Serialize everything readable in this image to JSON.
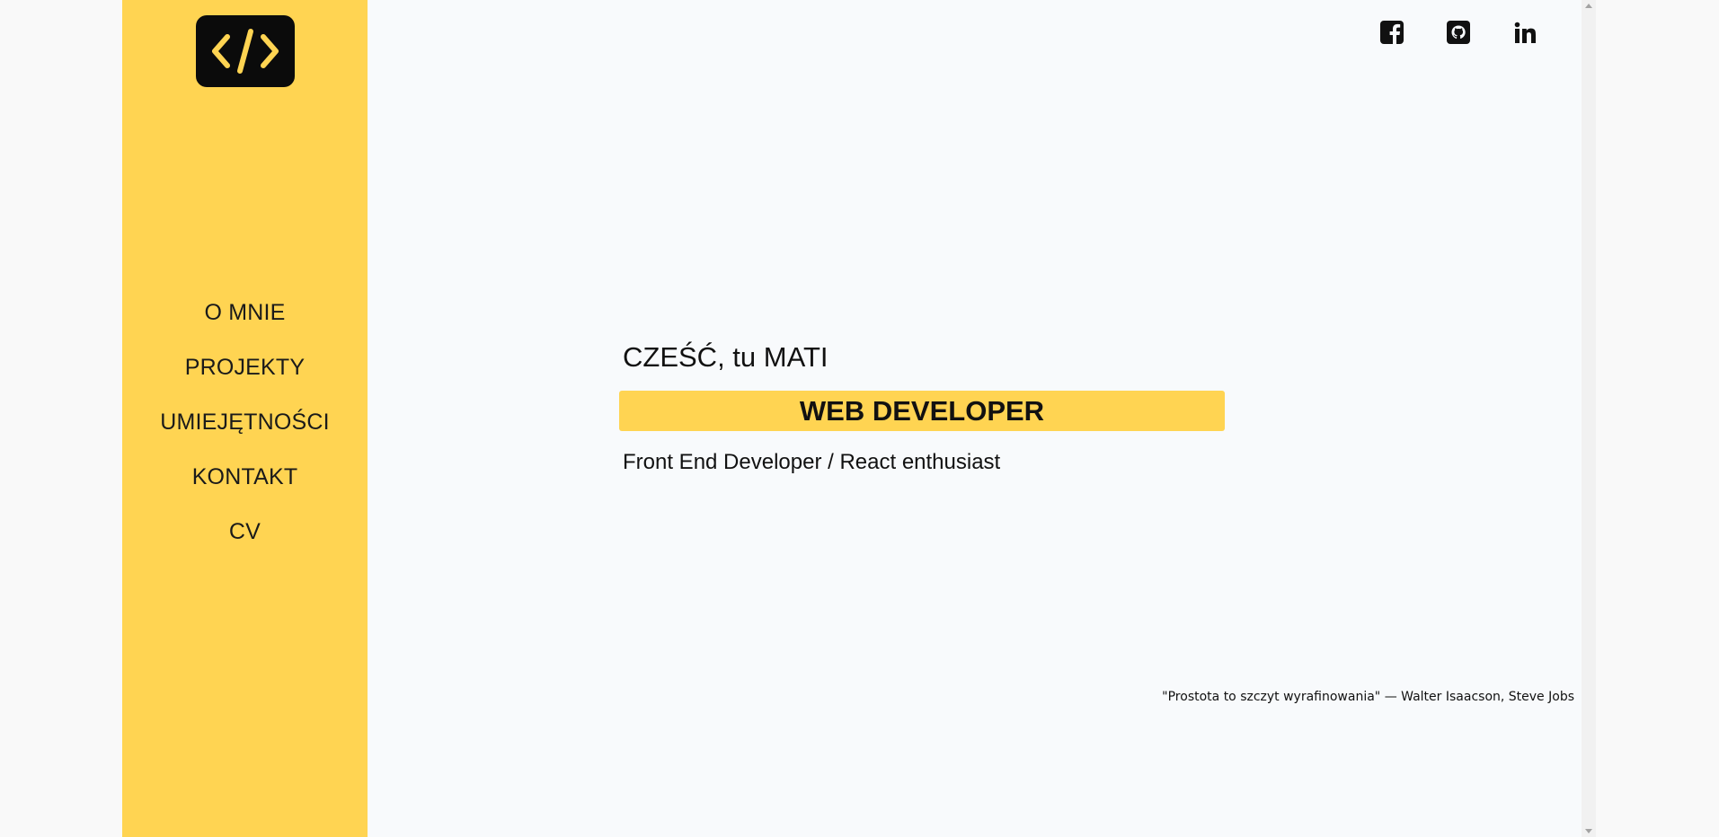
{
  "sidebar": {
    "logo_icon": "code-brackets-icon",
    "items": [
      {
        "label": "O MNIE"
      },
      {
        "label": "PROJEKTY"
      },
      {
        "label": "UMIEJĘTNOŚCI"
      },
      {
        "label": "KONTAKT"
      },
      {
        "label": "CV"
      }
    ]
  },
  "social": {
    "items": [
      {
        "icon": "facebook-icon"
      },
      {
        "icon": "github-icon"
      },
      {
        "icon": "linkedin-icon"
      }
    ]
  },
  "hero": {
    "greeting": "CZEŚĆ, tu MATI",
    "role": "WEB DEVELOPER",
    "subtitle": "Front End Developer / React enthusiast"
  },
  "quote": {
    "text": "\"Prostota to szczyt wyrafinowania\" — Walter Isaacson, Steve Jobs"
  },
  "colors": {
    "accent": "#ffd452",
    "background": "#f8fafc",
    "dark": "#0b0b0b"
  }
}
